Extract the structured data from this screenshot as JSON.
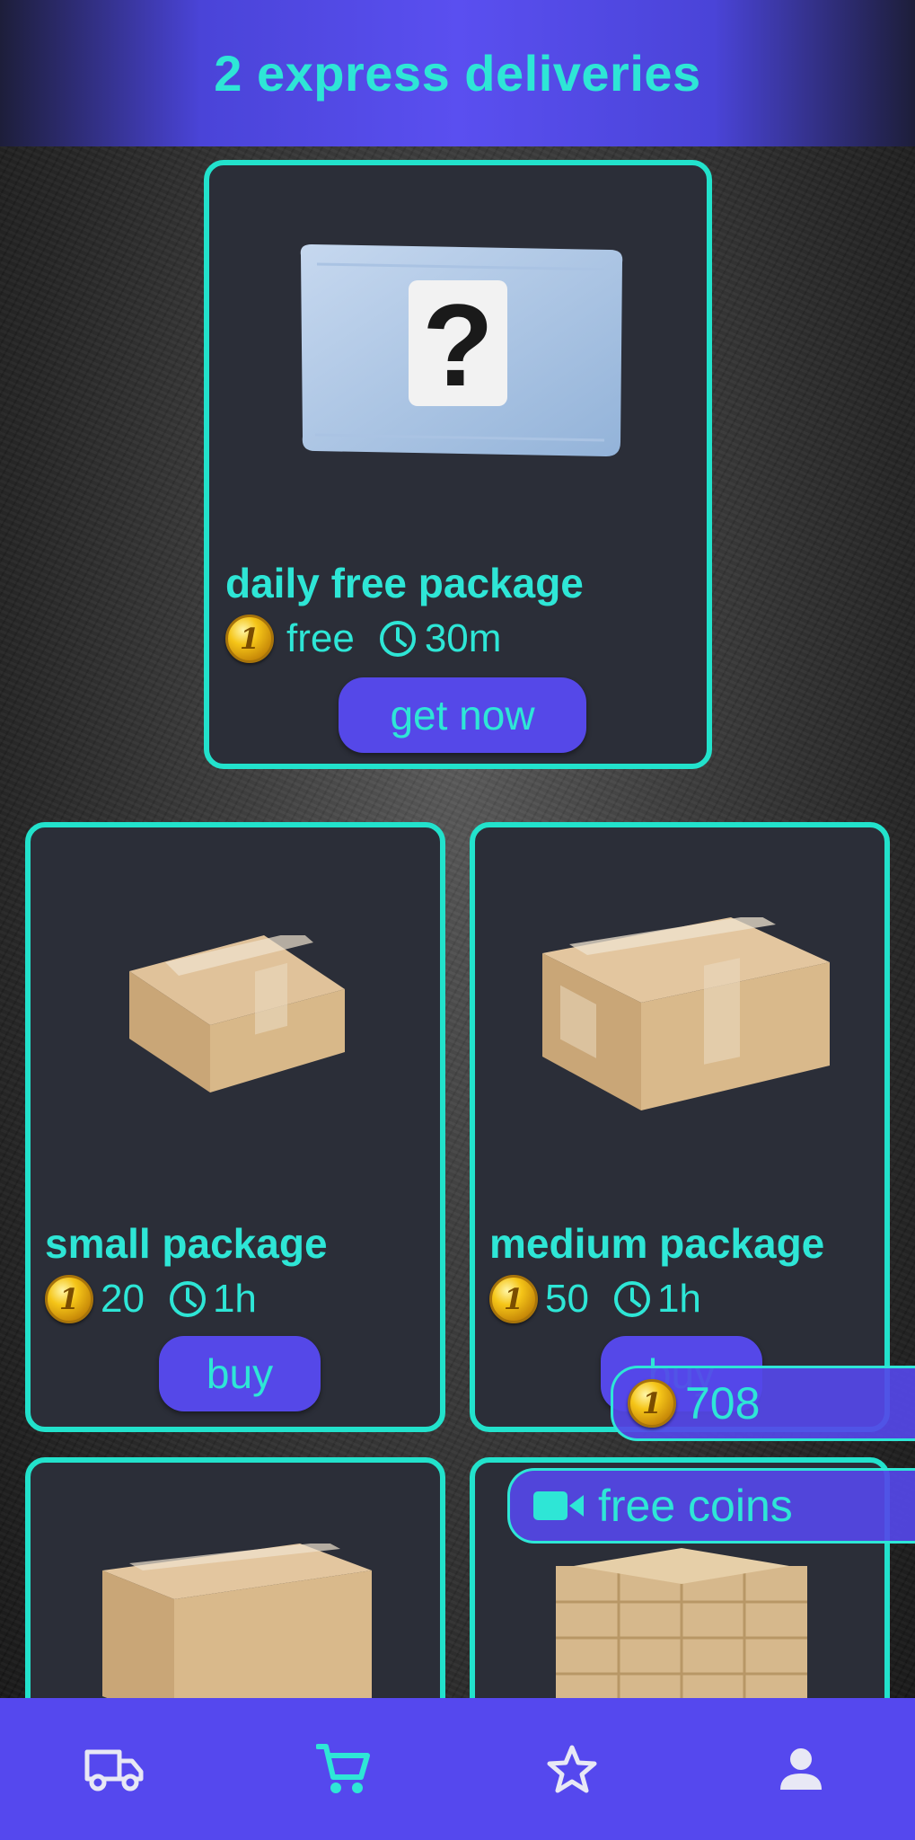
{
  "header": {
    "title": "2 express deliveries"
  },
  "featured": {
    "name": "daily free package",
    "price": "free",
    "time": "30m",
    "button_label": "get now",
    "image": "mystery-mailer-icon"
  },
  "packages": [
    {
      "name": "small package",
      "price": "20",
      "time": "1h",
      "button_label": "buy",
      "image": "small-box-icon"
    },
    {
      "name": "medium package",
      "price": "50",
      "time": "1h",
      "button_label": "buy",
      "image": "medium-box-icon"
    },
    {
      "image": "large-box-icon"
    },
    {
      "image": "pallet-boxes-icon"
    }
  ],
  "overlay": {
    "balance": "708",
    "free_coins_label": "free coins",
    "free_coins_icon": "video-camera-icon"
  },
  "coin_glyph": "1",
  "nav": {
    "items": [
      "truck-icon",
      "cart-icon",
      "star-icon",
      "person-icon"
    ],
    "active_index": 1
  },
  "colors": {
    "accent": "#2ee6d6",
    "brand": "#5548ee",
    "card_bg": "#2b2e38",
    "card_border": "#22e2cc"
  }
}
